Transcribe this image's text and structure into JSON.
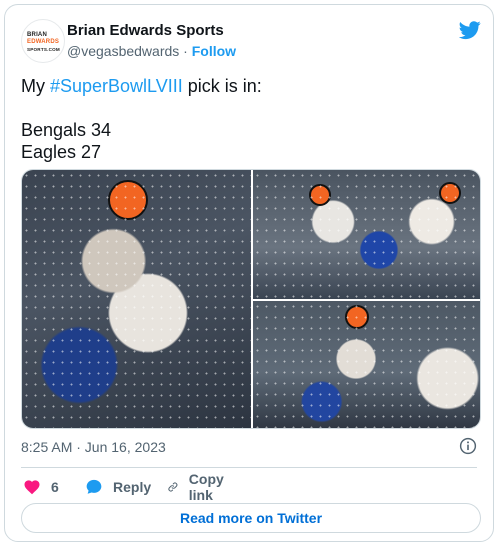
{
  "author": {
    "display_name": "Brian Edwards Sports",
    "handle": "@vegasbedwards",
    "separator": "·",
    "follow_label": "Follow",
    "avatar_lines": [
      "BRIAN",
      "EDWARDS",
      "SPORTS.COM"
    ]
  },
  "tweet": {
    "prefix": "My ",
    "hashtag": "#SuperBowlLVIII",
    "suffix": " pick is in:",
    "line2": "Bengals 34",
    "line3": "Eagles 27"
  },
  "timestamp": "8:25 AM · Jun 16, 2023",
  "actions": {
    "like_count": "6",
    "reply_label": "Reply",
    "copy_label": "Copy link"
  },
  "read_more_label": "Read more on Twitter",
  "colors": {
    "accent": "#1d9bf0",
    "heart": "#f91880",
    "brand_orange": "#f26522"
  },
  "icons": [
    "twitter-bird-icon",
    "info-icon",
    "heart-icon",
    "reply-bubble-icon",
    "link-icon"
  ]
}
